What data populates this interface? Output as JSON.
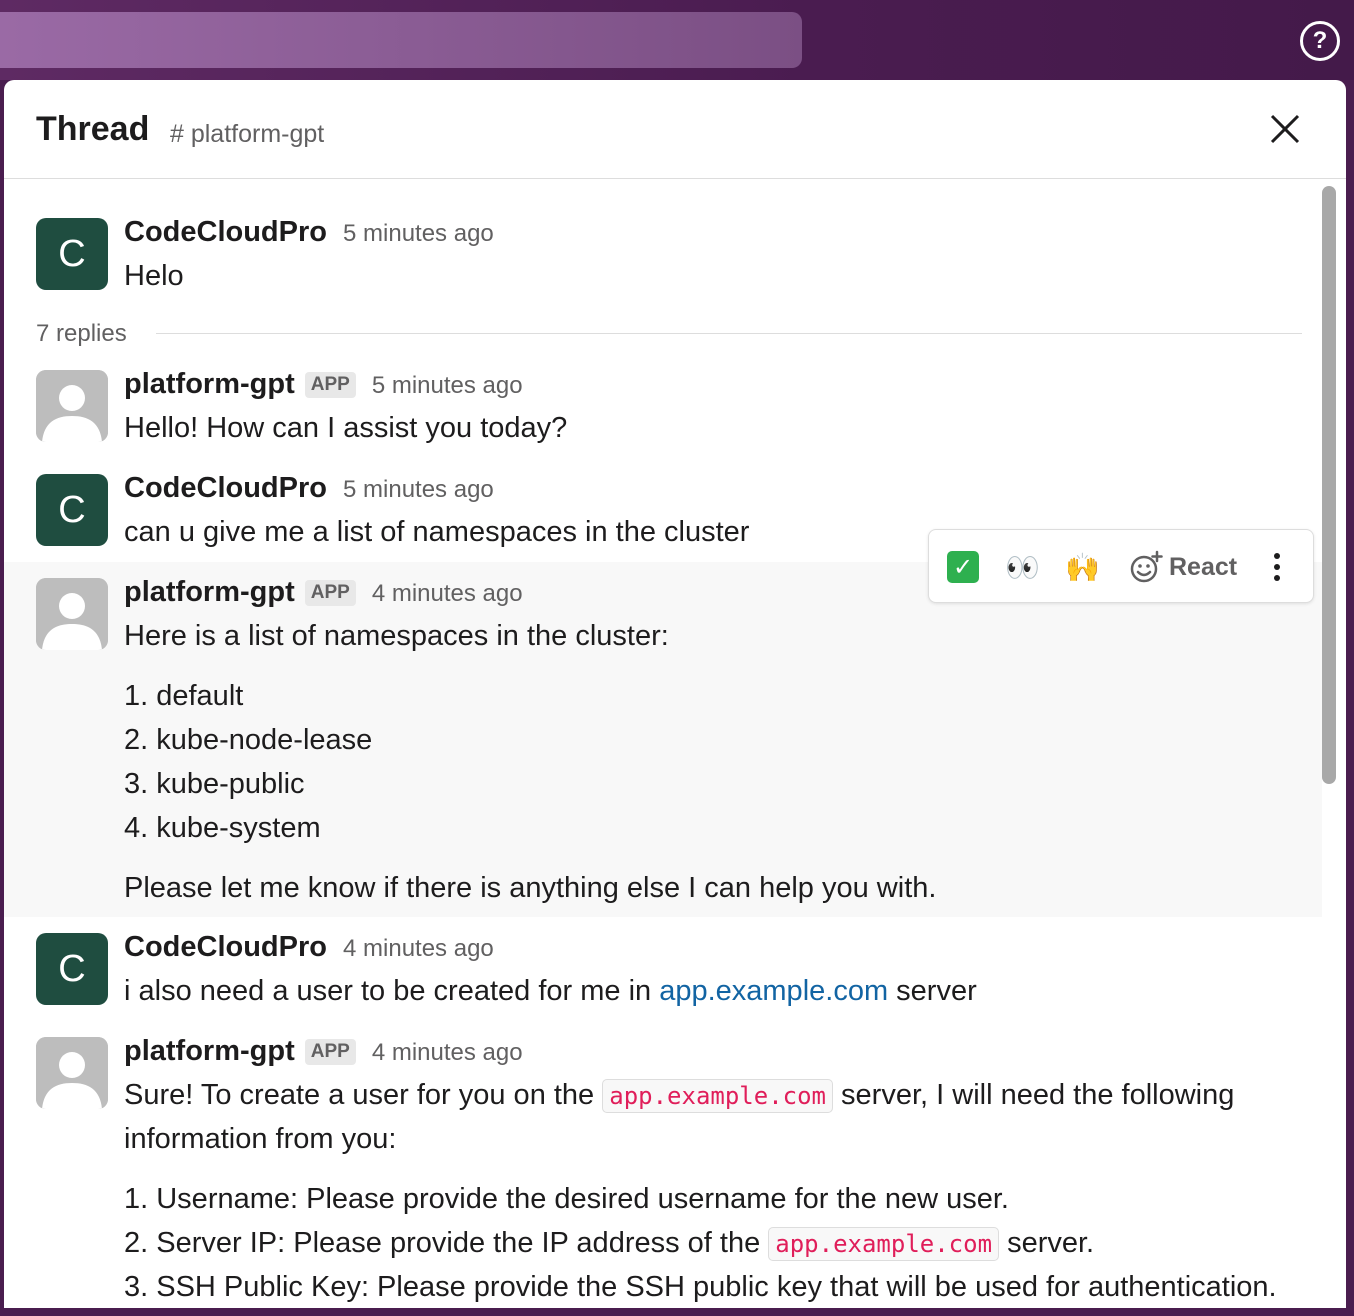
{
  "topbar": {
    "help_icon": "question-circle-icon",
    "help_label": "?"
  },
  "thread": {
    "title": "Thread",
    "channel": "# platform-gpt",
    "close_icon": "close-icon"
  },
  "root": {
    "author": "CodeCloudPro",
    "avatar_letter": "C",
    "time": "5 minutes ago",
    "text": "Helo"
  },
  "replies_label": "7 replies",
  "messages": [
    {
      "author": "platform-gpt",
      "badge": "APP",
      "time": "5 minutes ago",
      "text": "Hello! How can I assist you today?"
    },
    {
      "author": "CodeCloudPro",
      "avatar_letter": "C",
      "time": "5 minutes ago",
      "text": "can u give me a list of namespaces in the cluster"
    },
    {
      "author": "platform-gpt",
      "badge": "APP",
      "time": "4 minutes ago",
      "intro": "Here is a list of namespaces in the cluster:",
      "items": [
        "1. default",
        "2. kube-node-lease",
        "3. kube-public",
        "4. kube-system"
      ],
      "outro": "Please let me know if there is anything else I can help you with."
    },
    {
      "author": "CodeCloudPro",
      "avatar_letter": "C",
      "time": "4 minutes ago",
      "text_before": "i also need a user to be created for me in ",
      "link": "app.example.com",
      "text_after": " server"
    },
    {
      "author": "platform-gpt",
      "badge": "APP",
      "time": "4 minutes ago",
      "line1_before": "Sure! To create a user for you on the ",
      "line1_code": "app.example.com",
      "line1_after": " server, I will need the following",
      "line2": "information from you:",
      "item1": "1. Username: Please provide the desired username for the new user.",
      "item2_before": "2. Server IP: Please provide the IP address of the ",
      "item2_code": "app.example.com",
      "item2_after": " server.",
      "item3": "3. SSH Public Key: Please provide the SSH public key that will be used for authentication."
    }
  ],
  "reaction_bar": {
    "emoji_1": "white-check-mark",
    "emoji_2": "👀",
    "emoji_3": "🙌",
    "react_label": "React",
    "react_icon": "add-reaction-icon",
    "more_icon": "more-actions-icon"
  },
  "colors": {
    "aubergine": "#4a1d4f",
    "avatar_green": "#1f4d40",
    "link_blue": "#1264a3",
    "code_red": "#e01e5a"
  }
}
